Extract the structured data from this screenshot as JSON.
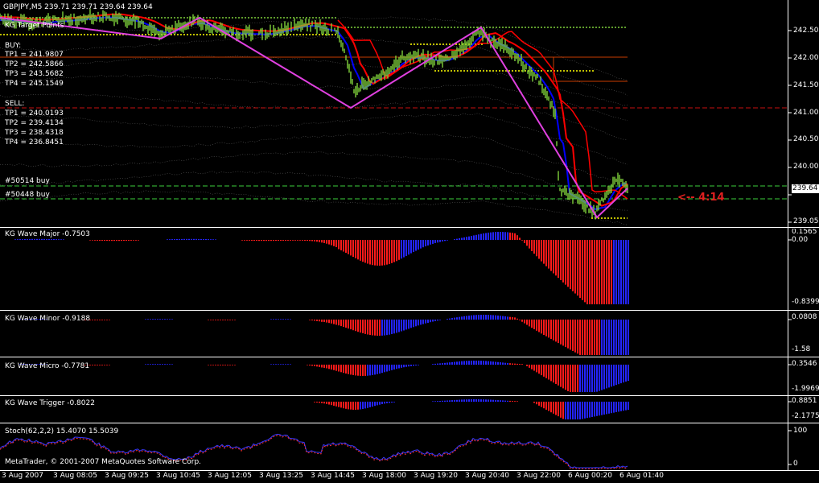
{
  "main": {
    "header": "GBPJPY,M5  239.71 239.71 239.64 239.64",
    "indicator_name": "KG Target Points",
    "buy": {
      "title": "BUY:",
      "tp": [
        "TP1 = 241.9807",
        "TP2 = 242.5866",
        "TP3 = 243.5682",
        "TP4 = 245.1549"
      ]
    },
    "sell": {
      "title": "SELL:",
      "tp": [
        "TP1 = 240.0193",
        "TP2 = 239.4134",
        "TP3 = 238.4318",
        "TP4 = 236.8451"
      ]
    },
    "orders": [
      "#50514 buy",
      "#50448 buy"
    ],
    "timer": "<-- 4:14",
    "current_price": "239.64",
    "price_axis": [
      "242.50",
      "242.00",
      "241.50",
      "241.00",
      "240.50",
      "240.00",
      "239.05"
    ],
    "colors": {
      "ma_red": "#ff0000",
      "ma_blue": "#0000ff",
      "zigzag": "#e040e0",
      "green_dotted": "#7fd13b",
      "yellow_dotted": "#ffff00",
      "sell_line": "#c83c00",
      "bands": "#808080",
      "candle": "#7fd13b"
    }
  },
  "panels": [
    {
      "title": "KG Wave Major  -0.7503",
      "axis": [
        "0.1565",
        "0.00",
        "-0.8399"
      ]
    },
    {
      "title": "KG Wave Minor  -0.9188",
      "axis": [
        "0.0808",
        "-1.58"
      ]
    },
    {
      "title": "KG Wave Micro  -0.7781",
      "axis": [
        "0.3546",
        "-1.9969"
      ]
    },
    {
      "title": "KG Wave Trigger  -0.8022",
      "axis": [
        "0.8851",
        "-2.1775"
      ]
    },
    {
      "title": "Stoch(62,2,2) 15.4070 15.5039",
      "axis": [
        "100",
        "0"
      ]
    }
  ],
  "copyright": "MetaTrader, © 2001-2007 MetaQuotes Software Corp.",
  "time_axis": [
    "3 Aug 2007",
    "3 Aug 08:05",
    "3 Aug 09:25",
    "3 Aug 10:45",
    "3 Aug 12:05",
    "3 Aug 13:25",
    "3 Aug 14:45",
    "3 Aug 18:00",
    "3 Aug 19:20",
    "3 Aug 20:40",
    "3 Aug 22:00",
    "6 Aug 00:20",
    "6 Aug 01:40"
  ],
  "chart_data": [
    {
      "type": "line",
      "title": "GBPJPY,M5",
      "x": [
        "3 Aug 2007",
        "3 Aug 08:05",
        "3 Aug 09:25",
        "3 Aug 10:45",
        "3 Aug 12:05",
        "3 Aug 13:25",
        "3 Aug 14:45",
        "3 Aug 18:00",
        "3 Aug 19:20",
        "3 Aug 20:40",
        "3 Aug 22:00",
        "6 Aug 00:20",
        "6 Aug 01:40"
      ],
      "series": [
        {
          "values": [
            242.65,
            242.7,
            242.58,
            242.55,
            242.55,
            242.5,
            242.4,
            241.45,
            242.0,
            242.3,
            241.6,
            239.35,
            239.64
          ]
        }
      ],
      "ylim": [
        238.9,
        242.75
      ]
    },
    {
      "type": "bar",
      "title": "KG Wave Major  -0.7503",
      "ylim": [
        -0.84,
        0.16
      ]
    },
    {
      "type": "bar",
      "title": "KG Wave Minor  -0.9188",
      "ylim": [
        -1.58,
        0.08
      ]
    },
    {
      "type": "bar",
      "title": "KG Wave Micro  -0.7781",
      "ylim": [
        -1.9969,
        0.3546
      ]
    },
    {
      "type": "bar",
      "title": "KG Wave Trigger  -0.8022",
      "ylim": [
        -2.1775,
        0.8851
      ]
    },
    {
      "type": "line",
      "title": "Stoch(62,2,2) 15.4070 15.5039",
      "ylim": [
        0,
        100
      ]
    }
  ]
}
